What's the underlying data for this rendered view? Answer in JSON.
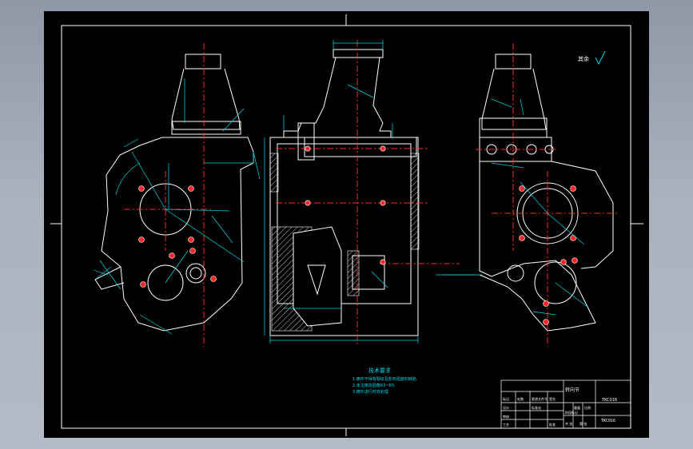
{
  "drawing": {
    "tech_requirements": {
      "title": "技术要求",
      "lines": [
        "1.铸件不得有裂纹及影响强度的缺陷.",
        "2.未注铸造圆角R3~R5.",
        "3.铸件进行时效处理."
      ]
    },
    "roughness_note": "其余",
    "title_block": {
      "part_name": "转向节",
      "drawing_number": "TKC016",
      "row_labels": [
        "标记",
        "处数",
        "分区",
        "更改文件号",
        "签名",
        "年月日"
      ],
      "role_labels": [
        "设计",
        "审核",
        "工艺",
        "批准"
      ],
      "field_labels": [
        "标准化",
        "阶段标记",
        "重量",
        "比例",
        "共  张",
        "第  张"
      ]
    }
  },
  "colors": {
    "sheet": "#000000",
    "border": "#ffffff",
    "outline": "#ffffff",
    "dimension": "#00d7e6",
    "centerline": "#ff2a2a",
    "hatch": "#c7c7c7",
    "background": "#a3acb9"
  }
}
